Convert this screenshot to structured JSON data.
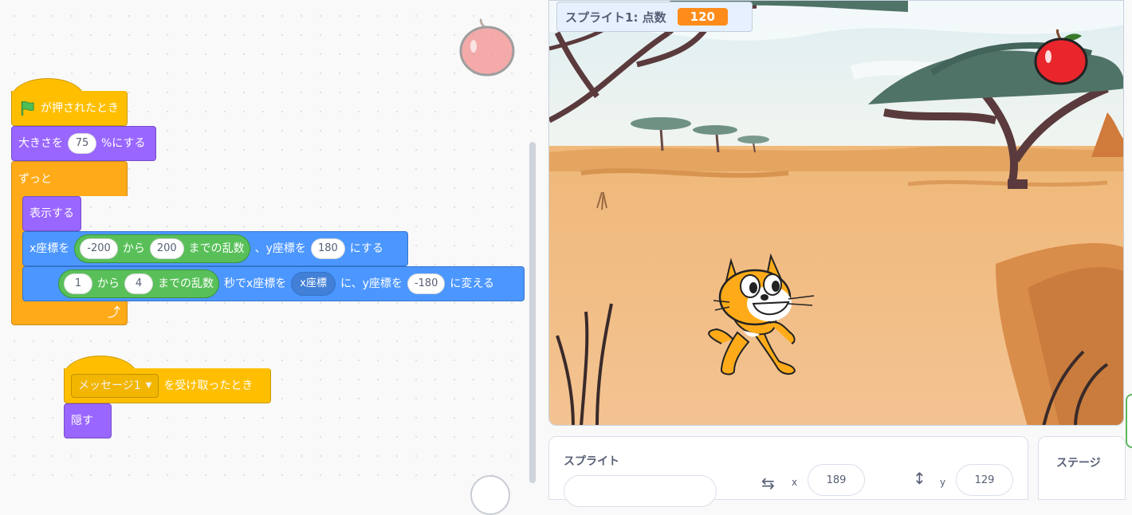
{
  "code": {
    "script1": {
      "hat": "が押されたとき",
      "set_size": {
        "prefix": "大きさを",
        "value": "75",
        "suffix": "%にする"
      },
      "forever": "ずっと",
      "show": "表示する",
      "goto": {
        "prefix": "x座標を",
        "rand_from": "-200",
        "rand_mid": "から",
        "rand_to": "200",
        "rand_suffix": "までの乱数",
        "y_label": "、y座標を",
        "y_value": "180",
        "suffix": "にする"
      },
      "glide": {
        "from": "1",
        "mid": "から",
        "to": "4",
        "rand_suffix": "までの乱数",
        "sec_label": "秒でx座標を",
        "x_reporter": "x座標",
        "y_label": "に、y座標を",
        "y_value": "-180",
        "suffix": "に変える"
      }
    },
    "script2": {
      "message": "メッセージ1",
      "receive_suffix": "を受け取ったとき",
      "hide": "隠す"
    }
  },
  "monitor": {
    "label": "スプライト1: 点数",
    "value": "120"
  },
  "sprite_info": {
    "title": "スプライト",
    "x_label": "x",
    "x_value": "189",
    "y_label": "y",
    "y_value": "129"
  },
  "stage_panel": {
    "title": "ステージ"
  },
  "colors": {
    "events": "#ffbf00",
    "looks": "#9966ff",
    "motion": "#4c97ff",
    "control": "#ffab19",
    "operators": "#59c059",
    "score": "#ff8c1a"
  }
}
